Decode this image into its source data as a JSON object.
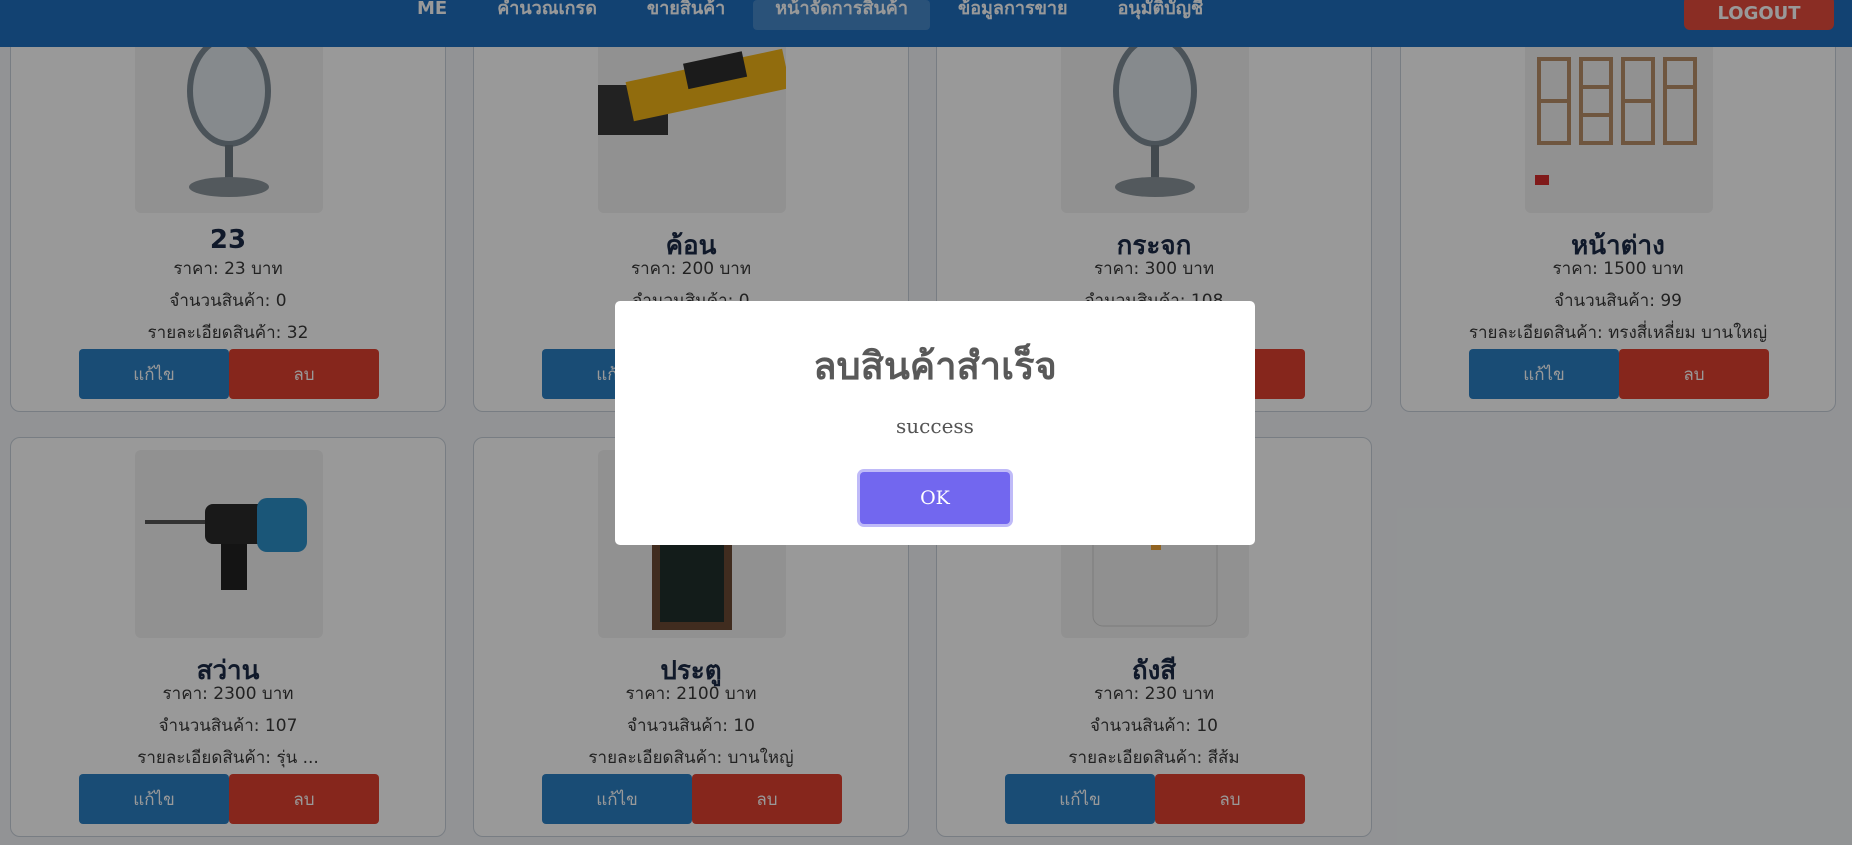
{
  "nav": {
    "items": [
      "ME",
      "คำนวณเกรด",
      "ขายสินค้า",
      "หน้าจัดการสินค้า",
      "ข้อมูลการขาย",
      "อนุมัติบัญชี"
    ],
    "active_index": 3,
    "logout_label": "LOGOUT"
  },
  "labels": {
    "edit": "แก้ไข",
    "delete": "ลบ"
  },
  "products": [
    {
      "name": "23",
      "price": "ราคา: 23 บาท",
      "stock": "จำนวนสินค้า: 0",
      "detail": "รายละเอียดสินค้า: 32",
      "image_icon": "mirror-icon"
    },
    {
      "name": "ค้อน",
      "price": "ราคา: 200 บาท",
      "stock": "จำนวนสินค้า: 0",
      "detail": "",
      "image_icon": "hammer-icon"
    },
    {
      "name": "กระจก",
      "price": "ราคา: 300 บาท",
      "stock": "จำนวนสินค้า: 108",
      "detail": "",
      "image_icon": "mirror-icon"
    },
    {
      "name": "หน้าต่าง",
      "price": "ราคา: 1500 บาท",
      "stock": "จำนวนสินค้า: 99",
      "detail": "รายละเอียดสินค้า: ทรงสี่เหลี่ยม บานใหญ่",
      "image_icon": "window-icon"
    },
    {
      "name": "สว่าน",
      "price": "ราคา: 2300 บาท",
      "stock": "จำนวนสินค้า: 107",
      "detail": "รายละเอียดสินค้า: รุ่น ...",
      "image_icon": "drill-icon"
    },
    {
      "name": "ประตู",
      "price": "ราคา: 2100 บาท",
      "stock": "จำนวนสินค้า: 10",
      "detail": "รายละเอียดสินค้า: บานใหญ่",
      "image_icon": "door-icon"
    },
    {
      "name": "ถังสี",
      "price": "ราคา: 230 บาท",
      "stock": "จำนวนสินค้า: 10",
      "detail": "รายละเอียดสินค้า: สีส้ม",
      "image_icon": "paint-bucket-icon"
    }
  ],
  "modal": {
    "title": "ลบสินค้าสำเร็จ",
    "message": "success",
    "ok_label": "OK"
  }
}
